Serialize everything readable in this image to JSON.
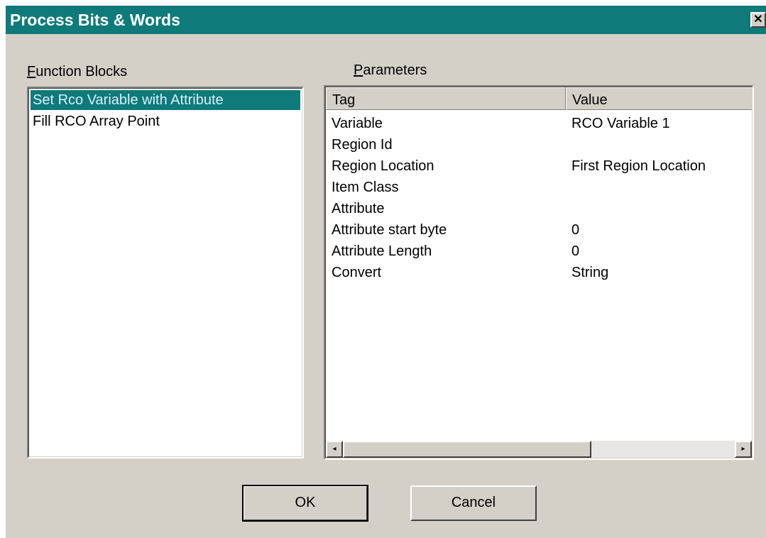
{
  "window": {
    "title": "Process Bits & Words",
    "close_glyph": "✕"
  },
  "function_blocks": {
    "label_first": "F",
    "label_rest": "unction Blocks",
    "items": [
      {
        "label": "Set Rco Variable with Attribute",
        "selected": true
      },
      {
        "label": "Fill RCO Array Point",
        "selected": false
      }
    ]
  },
  "parameters": {
    "label_first": "P",
    "label_rest": "arameters",
    "columns": {
      "tag": "Tag",
      "value": "Value"
    },
    "rows": [
      {
        "tag": "Variable",
        "value": "RCO Variable 1"
      },
      {
        "tag": "Region Id",
        "value": ""
      },
      {
        "tag": "Region Location",
        "value": "First Region Location"
      },
      {
        "tag": "Item Class",
        "value": ""
      },
      {
        "tag": "Attribute",
        "value": ""
      },
      {
        "tag": "Attribute start byte",
        "value": "0"
      },
      {
        "tag": "Attribute Length",
        "value": "0"
      },
      {
        "tag": "Convert",
        "value": "String"
      }
    ],
    "scroll_left_glyph": "◂",
    "scroll_right_glyph": "▸"
  },
  "buttons": {
    "ok": "OK",
    "cancel": "Cancel"
  },
  "colors": {
    "titlebar": "#0e7a7a",
    "dialog_bg": "#d4d0c8",
    "selection": "#0e7a7a"
  }
}
